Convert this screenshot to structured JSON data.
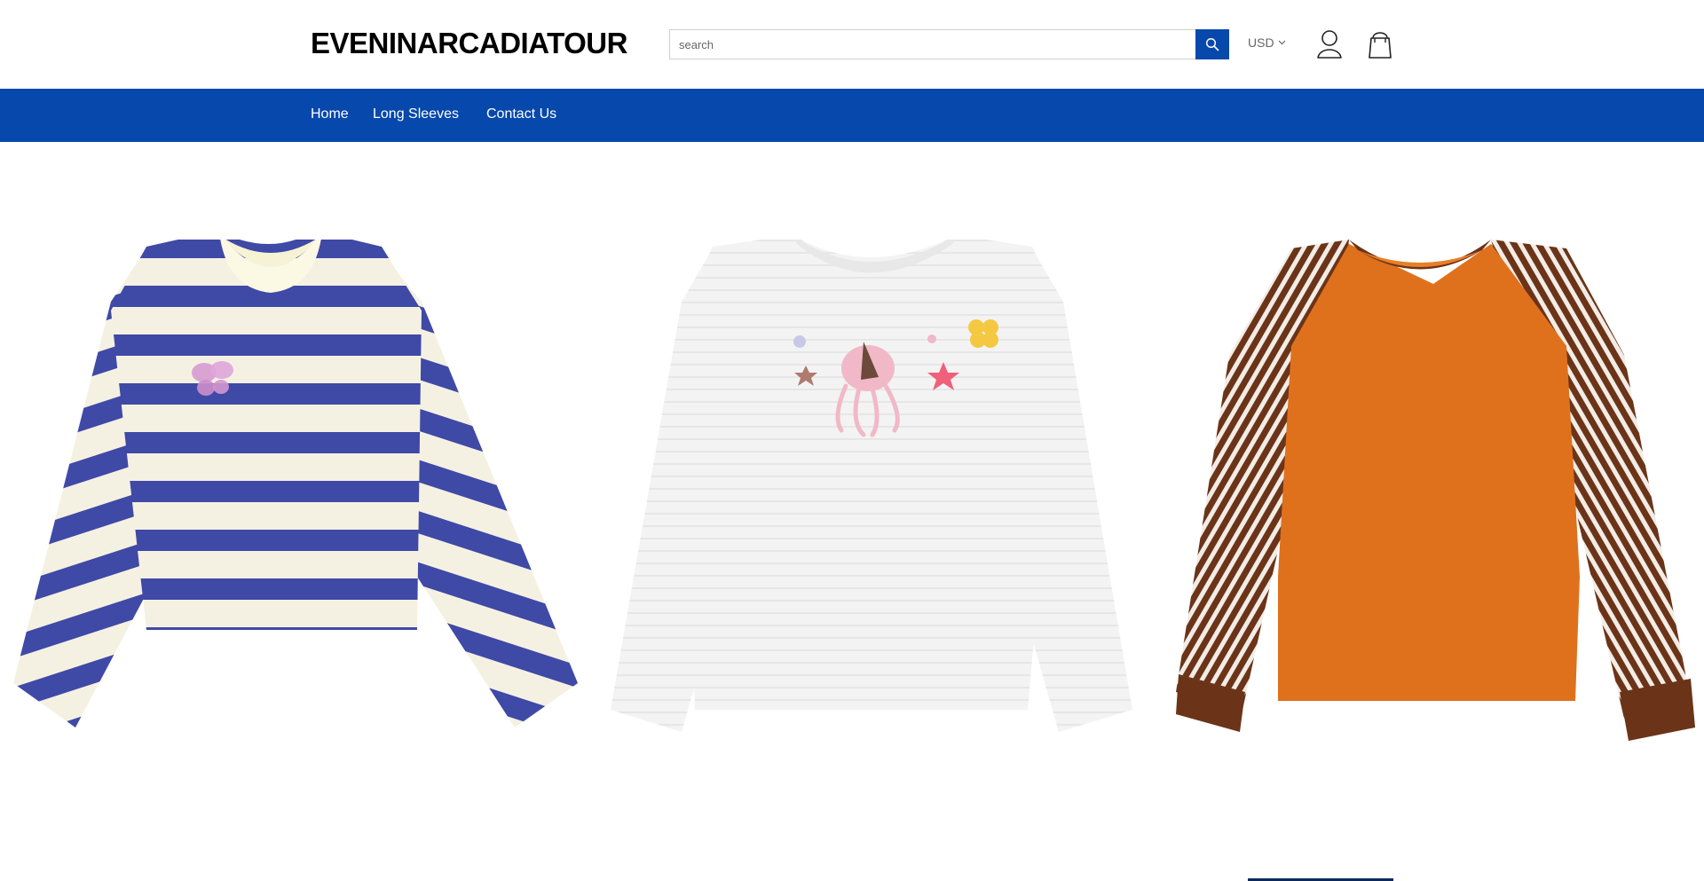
{
  "header": {
    "logo": "EVENINARCADIATOUR",
    "search": {
      "placeholder": "search",
      "value": ""
    },
    "currency": "USD"
  },
  "icons": {
    "search": "search-icon",
    "account": "user-icon",
    "cart": "shopping-bag-icon",
    "chevron": "chevron-down-icon"
  },
  "nav": {
    "items": [
      {
        "label": "Home"
      },
      {
        "label": "Long Sleeves"
      },
      {
        "label": "Contact Us"
      }
    ]
  },
  "colors": {
    "brand": "#0648ab",
    "stripe_blue": "#3f49a6",
    "cream": "#f5f1e2",
    "orange": "#df711d",
    "brown": "#6b3418"
  },
  "products": [
    {
      "image": "blue-white-striped-sweater-with-butterfly"
    },
    {
      "image": "white-knit-sweater-with-octopus"
    },
    {
      "image": "orange-raglan-sweater-with-striped-sleeves"
    }
  ]
}
